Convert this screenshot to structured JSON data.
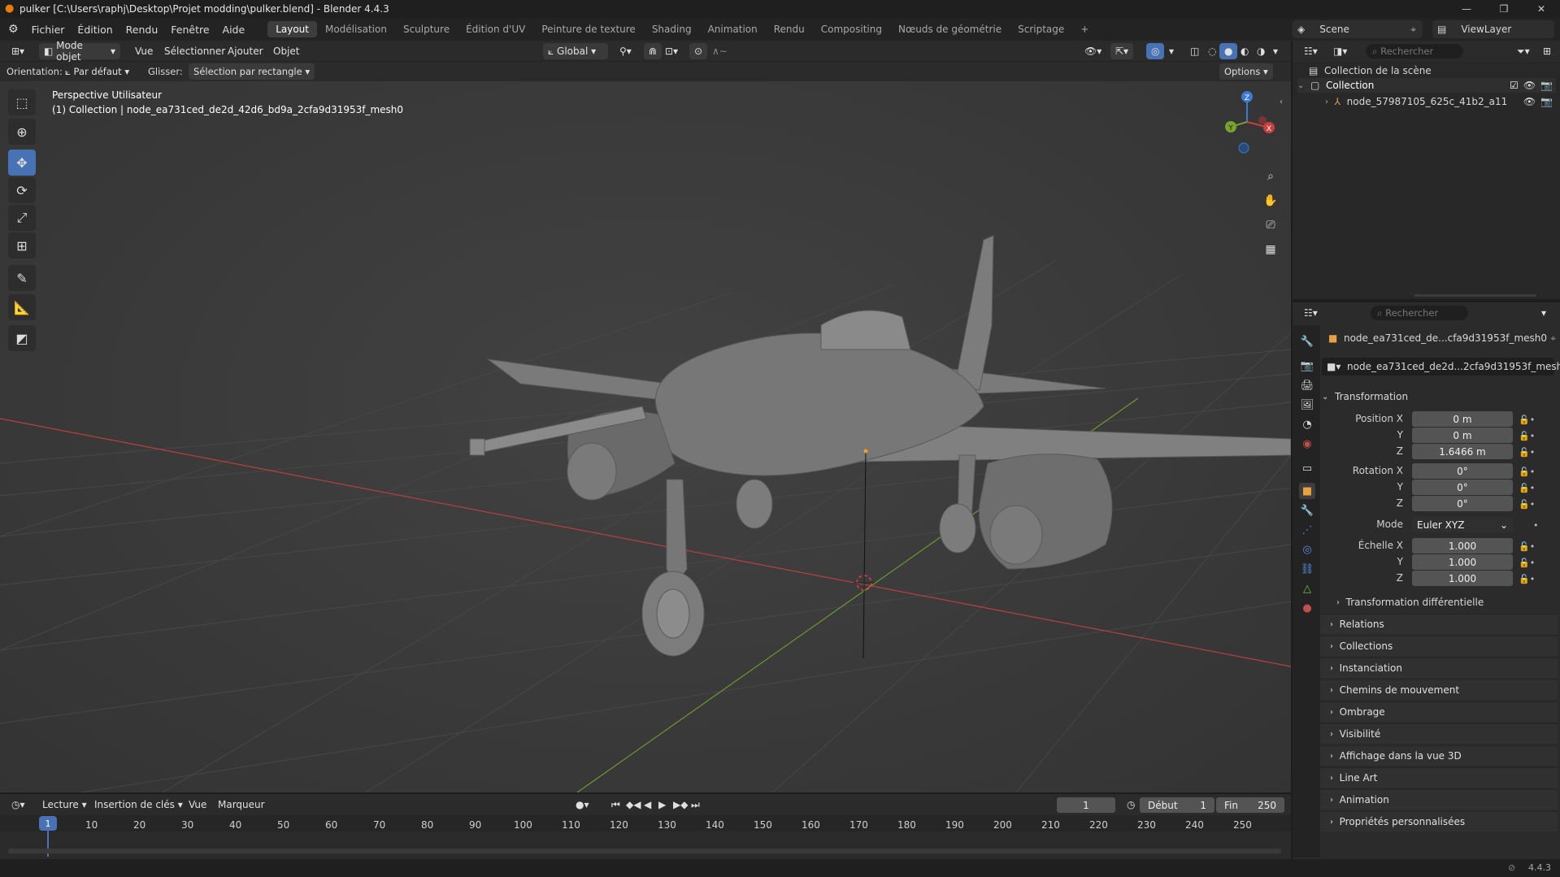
{
  "window": {
    "title": "pulker [C:\\Users\\raphj\\Desktop\\Projet modding\\pulker.blend] - Blender 4.4.3"
  },
  "menus": [
    "Fichier",
    "Édition",
    "Rendu",
    "Fenêtre",
    "Aide"
  ],
  "workspaces": [
    "Layout",
    "Modélisation",
    "Sculpture",
    "Édition d'UV",
    "Peinture de texture",
    "Shading",
    "Animation",
    "Rendu",
    "Compositing",
    "Nœuds de géométrie",
    "Scriptage"
  ],
  "scene": {
    "name": "Scene",
    "view_layer": "ViewLayer"
  },
  "viewport_header": {
    "mode": "Mode objet",
    "vue": "Vue",
    "select": "Sélectionner",
    "add": "Ajouter",
    "object": "Objet",
    "transform": "Global",
    "orientation_label": "Orientation:",
    "orientation_value": "Par défaut",
    "drag_label": "Glisser:",
    "drag_value": "Sélection par rectangle",
    "options": "Options"
  },
  "viewport_overlay": {
    "line1": "Perspective Utilisateur",
    "line2": "(1) Collection | node_ea731ced_de2d_42d6_bd9a_2cfa9d31953f_mesh0"
  },
  "gizmo": {
    "x": "X",
    "y": "Y",
    "z": "Z"
  },
  "outliner": {
    "search_placeholder": "Rechercher",
    "root": "Collection de la scène",
    "collection": "Collection",
    "object": "node_57987105_625c_41b2_a11"
  },
  "properties": {
    "search_placeholder": "Rechercher",
    "object_name": "node_ea731ced_de...cfa9d31953f_mesh0",
    "object_name2": "node_ea731ced_de2d...2cfa9d31953f_mesh0",
    "transform_title": "Transformation",
    "position_label": "Position X",
    "y_label": "Y",
    "z_label": "Z",
    "pos_x": "0 m",
    "pos_y": "0 m",
    "pos_z": "1.6466 m",
    "rotation_label": "Rotation X",
    "rot_x": "0°",
    "rot_y": "0°",
    "rot_z": "0°",
    "mode_label": "Mode",
    "mode_value": "Euler XYZ",
    "scale_label": "Échelle X",
    "scale_x": "1.000",
    "scale_y": "1.000",
    "scale_z": "1.000",
    "delta": "Transformation différentielle",
    "panels": [
      "Relations",
      "Collections",
      "Instanciation",
      "Chemins de mouvement",
      "Ombrage",
      "Visibilité",
      "Affichage dans la vue 3D",
      "Line Art",
      "Animation",
      "Propriétés personnalisées"
    ]
  },
  "timeline": {
    "playback": "Lecture",
    "keying": "Insertion de clés",
    "view": "Vue",
    "marker": "Marqueur",
    "current_frame": "1",
    "start_label": "Début",
    "start": "1",
    "end_label": "Fin",
    "end": "250",
    "ticks": [
      "1",
      "10",
      "20",
      "30",
      "40",
      "50",
      "60",
      "70",
      "80",
      "90",
      "100",
      "110",
      "120",
      "130",
      "140",
      "150",
      "160",
      "170",
      "180",
      "190",
      "200",
      "210",
      "220",
      "230",
      "240",
      "250"
    ]
  },
  "status": {
    "version": "4.4.3"
  },
  "colors": {
    "accent": "#4772b3",
    "x_axis": "#c8413f",
    "y_axis": "#79a32f",
    "z_axis": "#3b7bd4"
  }
}
